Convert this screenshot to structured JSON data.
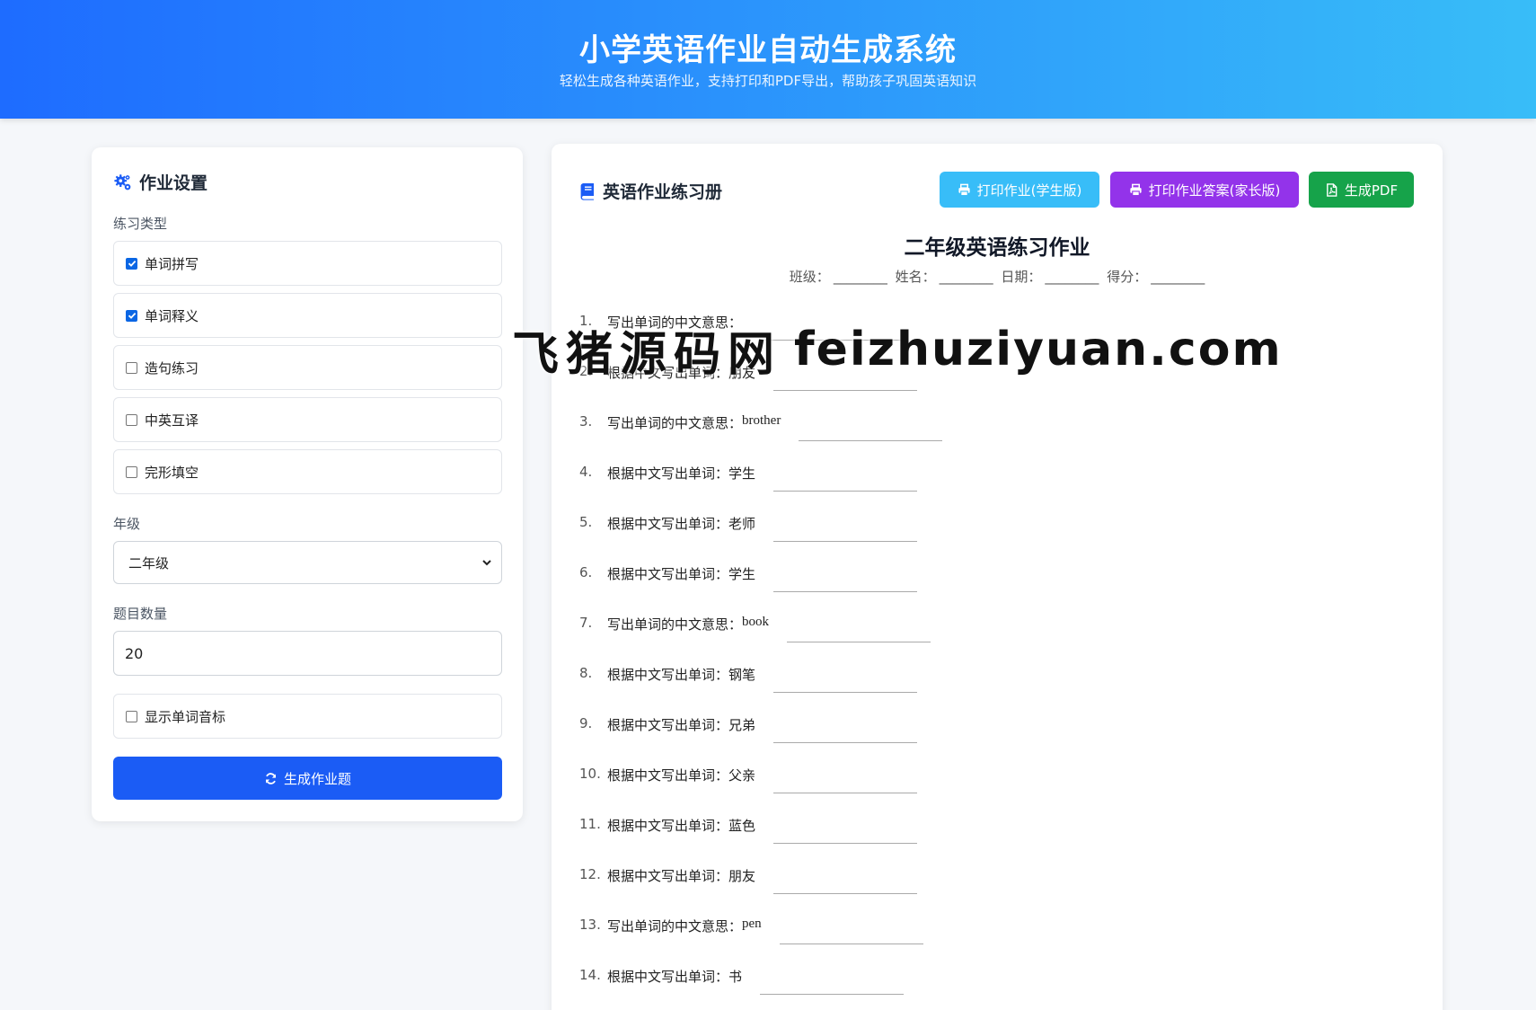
{
  "header": {
    "title": "小学英语作业自动生成系统",
    "subtitle": "轻松生成各种英语作业，支持打印和PDF导出，帮助孩子巩固英语知识"
  },
  "settings": {
    "title": "作业设置",
    "icon": "gears-icon",
    "exercise_type_label": "练习类型",
    "options": [
      {
        "label": "单词拼写",
        "checked": true
      },
      {
        "label": "单词释义",
        "checked": true
      },
      {
        "label": "造句练习",
        "checked": false
      },
      {
        "label": "中英互译",
        "checked": false
      },
      {
        "label": "完形填空",
        "checked": false
      }
    ],
    "grade_label": "年级",
    "grade_value": "二年级",
    "count_label": "题目数量",
    "count_value": "20",
    "phonetic_label": "显示单词音标",
    "phonetic_checked": false,
    "generate_label": "生成作业题",
    "accent": "#1b5cf5"
  },
  "workbook": {
    "title": "英语作业练习册",
    "icon": "book-icon",
    "buttons": {
      "print_student": "打印作业(学生版)",
      "print_answer": "打印作业答案(家长版)",
      "pdf": "生成PDF"
    },
    "button_colors": {
      "print_student": "#38bdf8",
      "print_answer": "#9333ea",
      "pdf": "#16a34a"
    },
    "sheet_title": "二年级英语练习作业",
    "meta": [
      {
        "label": "班级：",
        "blank": "________"
      },
      {
        "label": "姓名：",
        "blank": "________"
      },
      {
        "label": "日期：",
        "blank": "________"
      },
      {
        "label": "得分：",
        "blank": "________"
      }
    ],
    "questions": [
      {
        "num": "1.",
        "prompt": "写出单词的中文意思：",
        "word": ""
      },
      {
        "num": "2.",
        "prompt": "根据中文写出单词：",
        "word": "朋友"
      },
      {
        "num": "3.",
        "prompt": "写出单词的中文意思：",
        "word": "brother"
      },
      {
        "num": "4.",
        "prompt": "根据中文写出单词：",
        "word": "学生"
      },
      {
        "num": "5.",
        "prompt": "根据中文写出单词：",
        "word": "老师"
      },
      {
        "num": "6.",
        "prompt": "根据中文写出单词：",
        "word": "学生"
      },
      {
        "num": "7.",
        "prompt": "写出单词的中文意思：",
        "word": "book"
      },
      {
        "num": "8.",
        "prompt": "根据中文写出单词：",
        "word": "钢笔"
      },
      {
        "num": "9.",
        "prompt": "根据中文写出单词：",
        "word": "兄弟"
      },
      {
        "num": "10.",
        "prompt": "根据中文写出单词：",
        "word": "父亲"
      },
      {
        "num": "11.",
        "prompt": "根据中文写出单词：",
        "word": "蓝色"
      },
      {
        "num": "12.",
        "prompt": "根据中文写出单词：",
        "word": "朋友"
      },
      {
        "num": "13.",
        "prompt": "写出单词的中文意思：",
        "word": "pen"
      },
      {
        "num": "14.",
        "prompt": "根据中文写出单词：",
        "word": "书"
      }
    ]
  },
  "watermark": {
    "cn": "飞猪源码网",
    "en": "feizhuziyuan.com"
  }
}
